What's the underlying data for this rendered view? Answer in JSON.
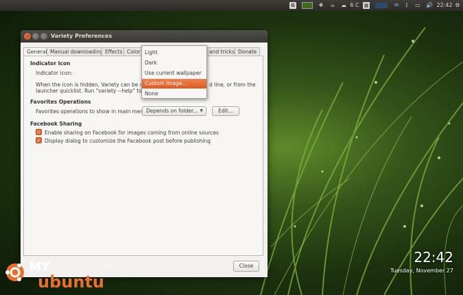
{
  "panel": {
    "weather": "6 C",
    "time": "22:42",
    "icons": [
      "indicator-g-icon",
      "thumbnail-icon",
      "dropbox-icon",
      "coffee-icon",
      "cloud-icon",
      "calendar-icon",
      "network-icon",
      "mail-icon",
      "bluetooth-icon",
      "battery-icon",
      "volume-icon",
      "gear-icon"
    ]
  },
  "window": {
    "title": "Variety Preferences",
    "tabs": [
      "General",
      "Manual downloading",
      "Effects",
      "Color a",
      "and tricks",
      "Donate"
    ],
    "indicator": {
      "heading": "Indicator Icon",
      "label": "Indicator icon:",
      "help1": "When the icon is hidden, Variety can be co",
      "help1b": "d line, or from the",
      "help2": "launcher quicklist. Run \"variety --help\" to see a"
    },
    "favorites": {
      "heading": "Favorites Operations",
      "label": "Favorites operations to show in main menu:",
      "combo_value": "Depends on folder...",
      "edit_button": "Edit..."
    },
    "facebook": {
      "heading": "Facebook Sharing",
      "opt1": "Enable sharing on Facebook for images coming from online sources",
      "opt2": "Display dialog to customize the Facebook post before publishing",
      "opt1_checked": true,
      "opt2_checked": true
    },
    "close_button": "Close"
  },
  "dropdown": {
    "items": [
      "Light",
      "Dark",
      "Use current wallpaper",
      "Custom image...",
      "None"
    ],
    "selected": "Custom image..."
  },
  "desktop": {
    "clock": "22:42",
    "date": "Tuesday, November 27"
  },
  "logo": {
    "top": "MY",
    "suffix": ".ru",
    "bottom": "ubuntu"
  }
}
